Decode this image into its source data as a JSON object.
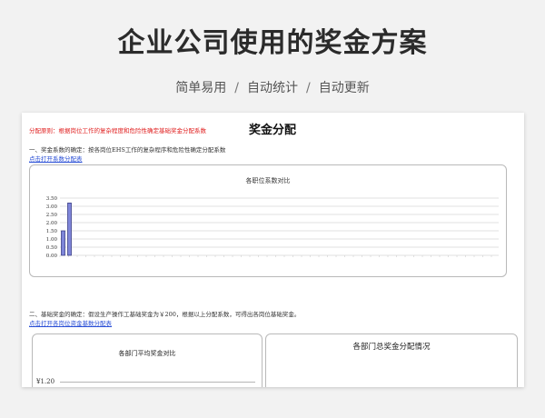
{
  "hero": {
    "title": "企业公司使用的奖金方案",
    "tags": [
      "简单易用",
      "自动统计",
      "自动更新"
    ],
    "separator": "/"
  },
  "sheet": {
    "title": "奖金分配",
    "principle": "分配原则：根据岗位工作的复杂程度和危险性确定基础奖金分配系数",
    "section1": "一、奖金系数的确定：按各岗位EHS工作的复杂程序和危险性确定分配系数",
    "link1": "点击打开系数分配表",
    "section2": "二、基础奖金的确定：假设生产操作工基础奖金为￥200，根据以上分配系数，可得出各岗位基础奖金。",
    "link2": "点击打开各岗位资金基数分配表",
    "panel_left_title": "各部门平均奖金对比",
    "panel_left_ytick": "¥1.20",
    "panel_right_title": "各部门总奖金分配情况"
  },
  "colors": {
    "bar_fill": "#7f86d9",
    "bar_stroke": "#2b2f7a",
    "principle_red": "#e02020",
    "link_blue": "#2a4fd6"
  },
  "chart_data": {
    "type": "bar",
    "title": "各职位系数对比",
    "ylim": [
      0,
      3.5
    ],
    "yticks": [
      "3.50",
      "3.00",
      "2.50",
      "2.00",
      "1.50",
      "1.00",
      "0.50",
      "0.00"
    ],
    "categories": [
      "",
      ""
    ],
    "values": [
      1.5,
      3.2
    ],
    "grid": true
  }
}
